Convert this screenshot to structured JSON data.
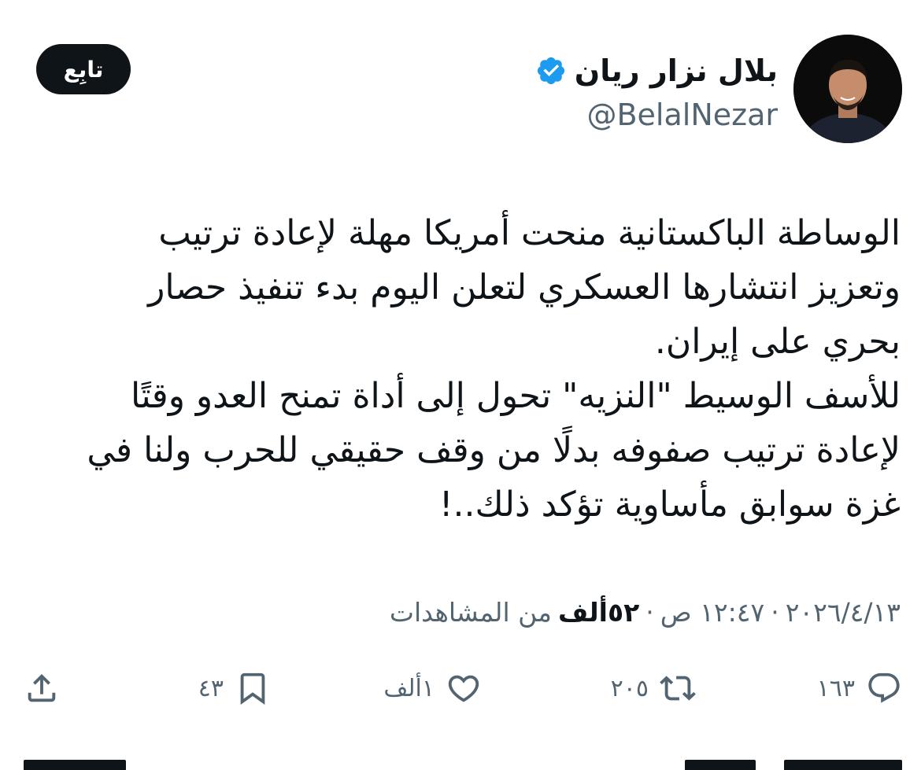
{
  "user": {
    "display_name": "بلال نزار ريان",
    "handle": "@BelalNezar",
    "verified_color": "#1d9bf0"
  },
  "follow_button": {
    "label": "تابِع"
  },
  "tweet": {
    "lines": [
      "الوساطة الباكستانية منحت أمريكا مهلة لإعادة ترتيب",
      "وتعزيز انتشارها العسكري لتعلن اليوم بدء تنفيذ حصار",
      "بحري على إيران.",
      "للأسف الوسيط \"النزيه\" تحول إلى أداة تمنح العدو وقتًا",
      "لإعادة ترتيب صفوفه بدلًا من وقف حقيقي للحرب ولنا في",
      "غزة سوابق مأساوية تؤكد ذلك..!"
    ]
  },
  "meta": {
    "date": "٢٠٢٦/٤/١٣",
    "time": "١٢:٤٧ ص",
    "views_count": "٥٢ألف",
    "views_label": "من المشاهدات",
    "separator": "·"
  },
  "actions": {
    "reply_count": "١٦٣",
    "retweet_count": "٢٠٥",
    "like_count": "١ألف",
    "bookmark_count": "٤٣"
  }
}
